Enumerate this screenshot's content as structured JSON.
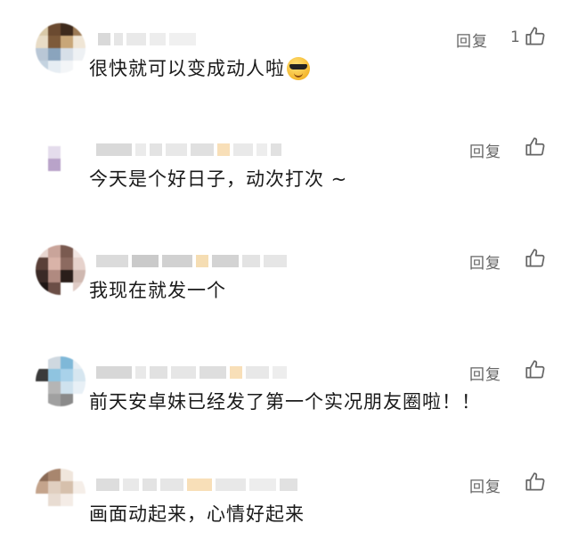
{
  "comments": [
    {
      "text": "很快就可以变成动人啦",
      "has_emoji": true,
      "emoji_icon": "smiling-face-with-sunglasses-icon",
      "reply_label": "回复",
      "like_count": "1",
      "avatar_colors": [
        "#d9c9a8",
        "#6b4a30",
        "#3e2a1c",
        "#9c7a55",
        "#e8dcc6",
        "#7d5a3a",
        "#c8a678",
        "#f0e6d6",
        "#b9c7d6",
        "#8aa4bd",
        "#d7dfe8",
        "#eef1f4",
        "#c4d3e0",
        "#e6edf3",
        "#f3f5f7",
        "#ffffff"
      ]
    },
    {
      "text": "今天是个好日子，动次打次 ~",
      "has_emoji": false,
      "reply_label": "回复",
      "like_count": "",
      "avatar_colors": [
        "#ffffff",
        "#ffffff",
        "#ffffff",
        "#ffffff",
        "#ffffff",
        "#e4dcec",
        "#ffffff",
        "#ffffff",
        "#ffffff",
        "#b9a3c9",
        "#ffffff",
        "#ffffff",
        "#ffffff",
        "#ffffff",
        "#ffffff",
        "#ffffff"
      ]
    },
    {
      "text": "我现在就发一个",
      "has_emoji": false,
      "reply_label": "回复",
      "like_count": "",
      "avatar_colors": [
        "#e8d6d0",
        "#c9a49a",
        "#7a5a50",
        "#f2e6e2",
        "#5a4038",
        "#d9b3a8",
        "#8c6a60",
        "#e6d2cc",
        "#3a2a26",
        "#b08a80",
        "#2a1e1a",
        "#cfb8b0",
        "#1e1614",
        "#6b4e46",
        "#ffffff",
        "#e0ccc6"
      ]
    },
    {
      "text": "前天安卓妹已经发了第一个实况朋友圈啦！！",
      "has_emoji": false,
      "reply_label": "回复",
      "like_count": "",
      "avatar_colors": [
        "#ffffff",
        "#cfd8e0",
        "#7fb8d8",
        "#e6eef4",
        "#3a3a3a",
        "#8fc4e0",
        "#a9d2ea",
        "#d6e6f0",
        "#ffffff",
        "#b5b5b5",
        "#cfe2ee",
        "#e8f0f6",
        "#ffffff",
        "#a0a0a0",
        "#8a8a8a",
        "#ffffff"
      ]
    },
    {
      "text": "画面动起来，心情好起来",
      "has_emoji": false,
      "reply_label": "回复",
      "like_count": "",
      "avatar_colors": [
        "#8a6a55",
        "#a8866e",
        "#f0e6dc",
        "#ffffff",
        "#c4a48c",
        "#e0cfc0",
        "#d6c0ac",
        "#f5eee8",
        "#ffffff",
        "#e8dcd2",
        "#f4ece6",
        "#ffffff",
        "#ffffff",
        "#ffffff",
        "#ffffff",
        "#ffffff"
      ]
    }
  ],
  "icons": {
    "like": "thumbs-up-outline-icon"
  },
  "colors": {
    "text": "#1a1a1a",
    "muted": "#666666",
    "redaction": "#d5d5d5"
  }
}
